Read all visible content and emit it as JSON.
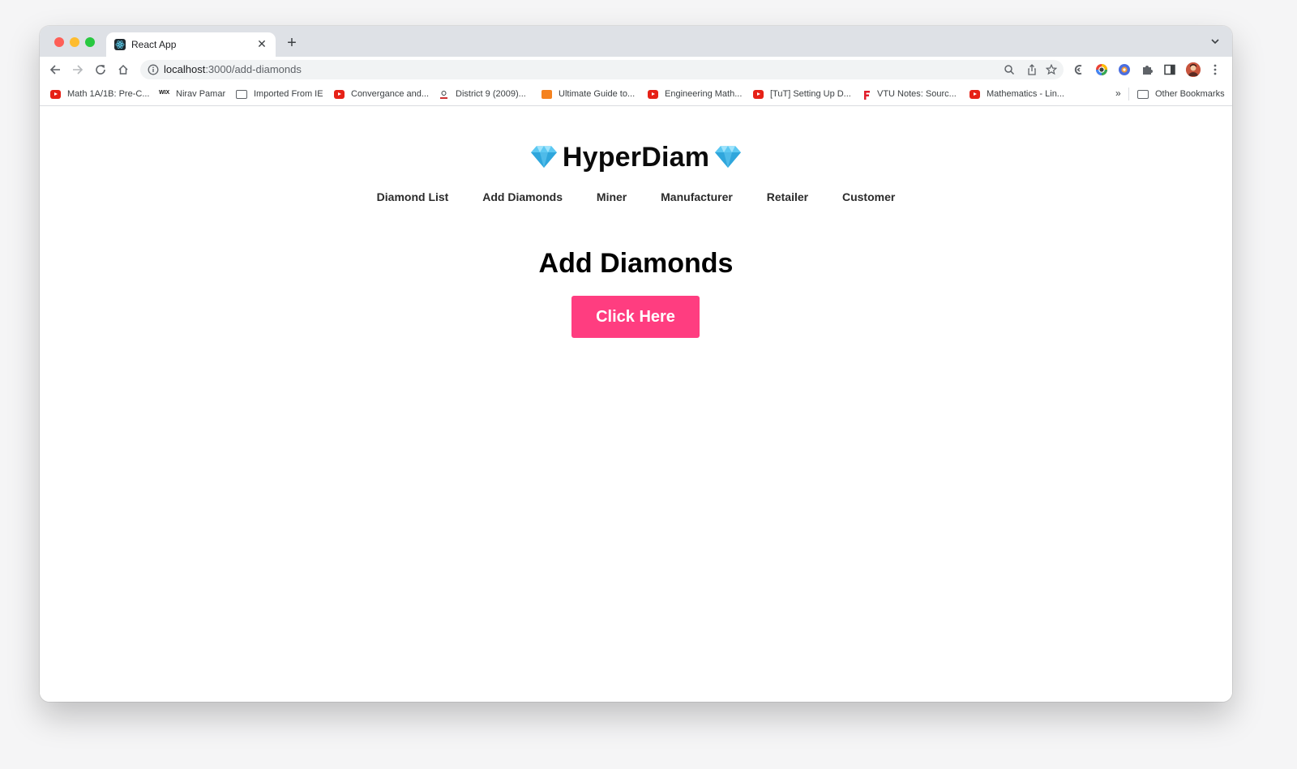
{
  "browser": {
    "tab": {
      "title": "React App"
    },
    "address": {
      "host": "localhost",
      "path": ":3000/add-diamonds"
    },
    "bookmarks": [
      {
        "label": "Math 1A/1B: Pre-C...",
        "icon": "youtube-icon"
      },
      {
        "label": "Nirav Pamar",
        "icon": "wix-icon"
      },
      {
        "label": "Imported From IE",
        "icon": "folder-icon"
      },
      {
        "label": "Convergance and...",
        "icon": "youtube-icon"
      },
      {
        "label": "District 9 (2009)...",
        "icon": "site-icon"
      },
      {
        "label": "Ultimate Guide to...",
        "icon": "site-icon"
      },
      {
        "label": "Engineering Math...",
        "icon": "youtube-icon"
      },
      {
        "label": "[TuT] Setting Up D...",
        "icon": "youtube-icon"
      },
      {
        "label": "VTU Notes: Sourc...",
        "icon": "site-icon"
      },
      {
        "label": "Mathematics - Lin...",
        "icon": "youtube-icon"
      }
    ],
    "more_bookmarks": "»",
    "other_bookmarks": "Other Bookmarks"
  },
  "app": {
    "brand": "HyperDiam",
    "nav": [
      "Diamond List",
      "Add Diamonds",
      "Miner",
      "Manufacturer",
      "Retailer",
      "Customer"
    ],
    "page_title": "Add Diamonds",
    "cta_label": "Click Here",
    "accent_color": "#ff3d80"
  }
}
